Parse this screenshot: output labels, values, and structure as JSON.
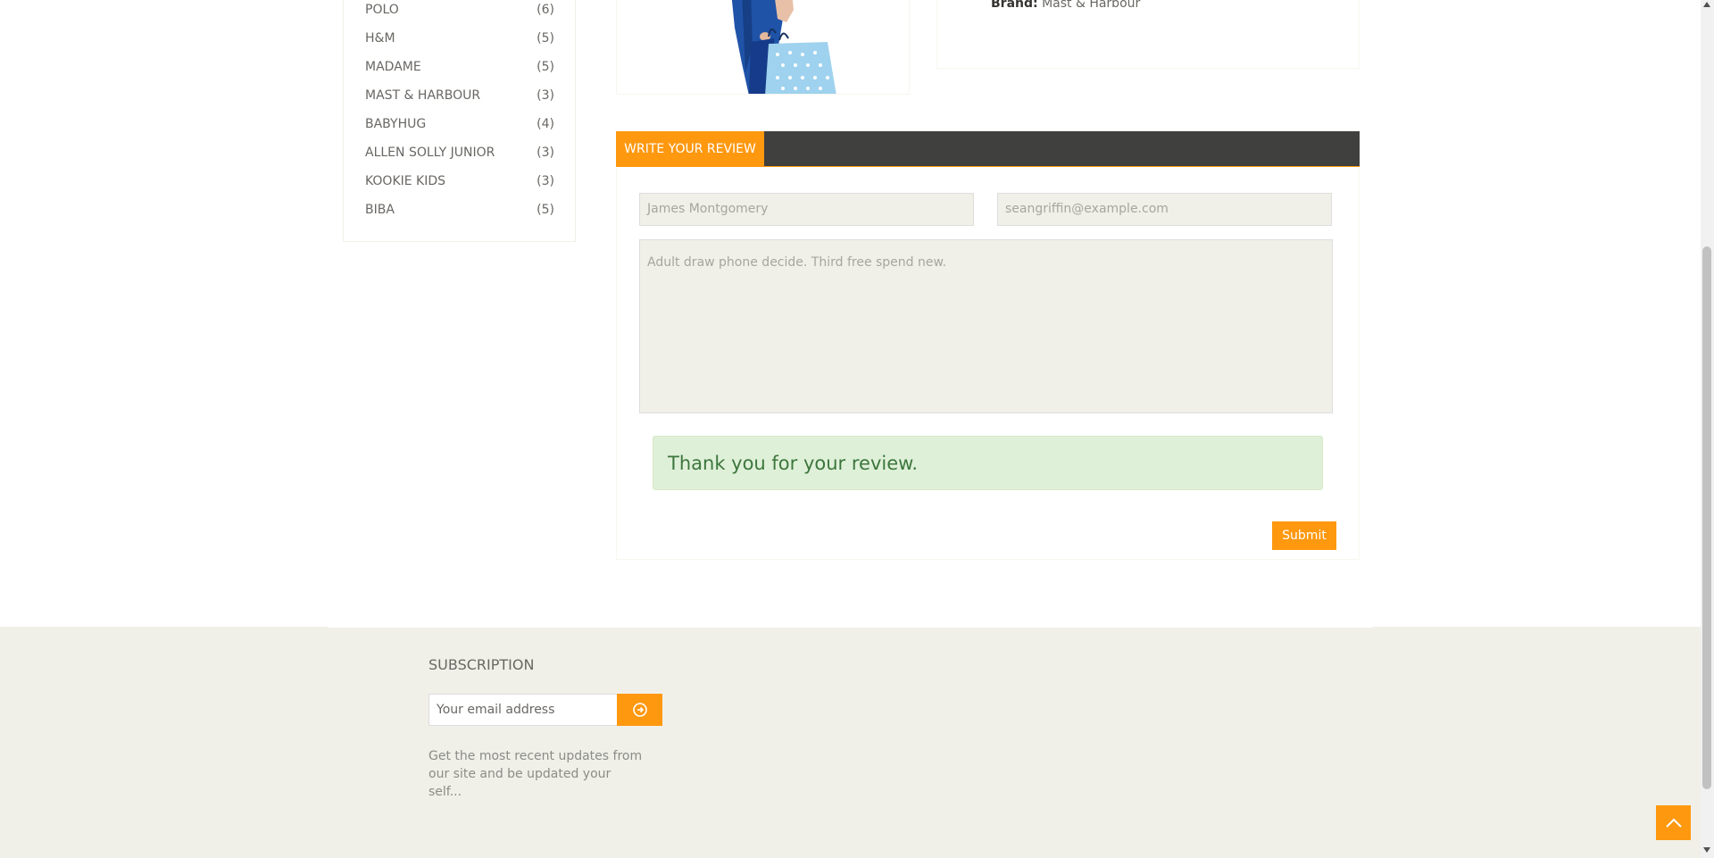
{
  "brands": [
    {
      "name": "POLO",
      "count": "(6)"
    },
    {
      "name": "H&M",
      "count": "(5)"
    },
    {
      "name": "MADAME",
      "count": "(5)"
    },
    {
      "name": "MAST & HARBOUR",
      "count": "(3)"
    },
    {
      "name": "BABYHUG",
      "count": "(4)"
    },
    {
      "name": "ALLEN SOLLY JUNIOR",
      "count": "(3)"
    },
    {
      "name": "KOOKIE KIDS",
      "count": "(3)"
    },
    {
      "name": "BIBA",
      "count": "(5)"
    }
  ],
  "product": {
    "brand_label": "Brand:",
    "brand_value": "Mast & Harbour"
  },
  "review": {
    "tab_label": "WRITE YOUR REVIEW",
    "name_value": "James Montgomery",
    "email_value": "seangriffin@example.com",
    "message_value": "Adult draw phone decide. Third free spend new.",
    "success_message": "Thank you for your review.",
    "submit_label": "Submit"
  },
  "footer": {
    "subscription_title": "SUBSCRIPTION",
    "email_placeholder": "Your email address",
    "description": "Get the most recent updates from our site and be updated your self..."
  },
  "colors": {
    "accent": "#fe980f",
    "dark_bar": "#40403e",
    "footer_bg": "#f0f0e9",
    "success_bg": "#dff0d8",
    "success_text": "#3c763d"
  }
}
